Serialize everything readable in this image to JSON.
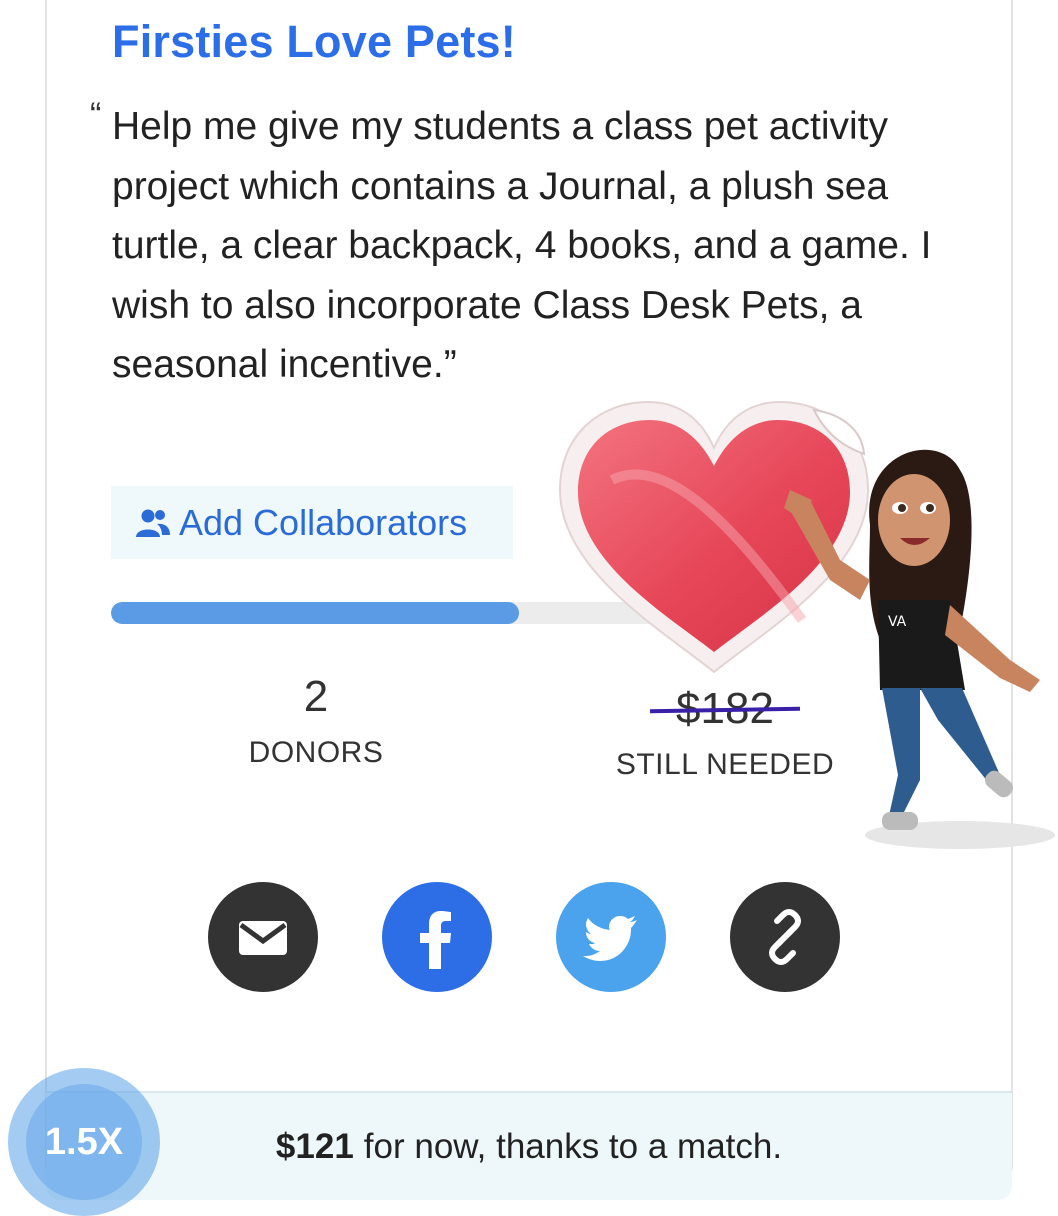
{
  "project": {
    "title": "Firsties Love Pets!",
    "quote_open": "“",
    "quote": "Help me give my students a class pet activity project which contains a Journal, a plush sea turtle, a clear backpack, 4 books, and a game. I wish to also incorporate Class Desk Pets, a seasonal incentive.”"
  },
  "collaborators": {
    "label": "Add Collaborators",
    "icon": "people-icon"
  },
  "progress": {
    "fraction": 0.68
  },
  "stats": {
    "donors_count": "2",
    "donors_label": "DONORS",
    "needed_amount": "$182",
    "needed_label": "STILL NEEDED"
  },
  "share": [
    {
      "icon": "email-icon",
      "color": "#333333"
    },
    {
      "icon": "facebook-icon",
      "color": "#2d6ee6"
    },
    {
      "icon": "twitter-icon",
      "color": "#4aa3ec"
    },
    {
      "icon": "link-icon",
      "color": "#333333"
    }
  ],
  "match": {
    "amount": "$121",
    "text": "for now, thanks to a match."
  },
  "playback": {
    "speed": "1.5X"
  },
  "colors": {
    "title": "#2c6ee8",
    "progress": "#5b9be6",
    "strike": "#3a1fa8",
    "footer_bg": "#eef8fb"
  }
}
